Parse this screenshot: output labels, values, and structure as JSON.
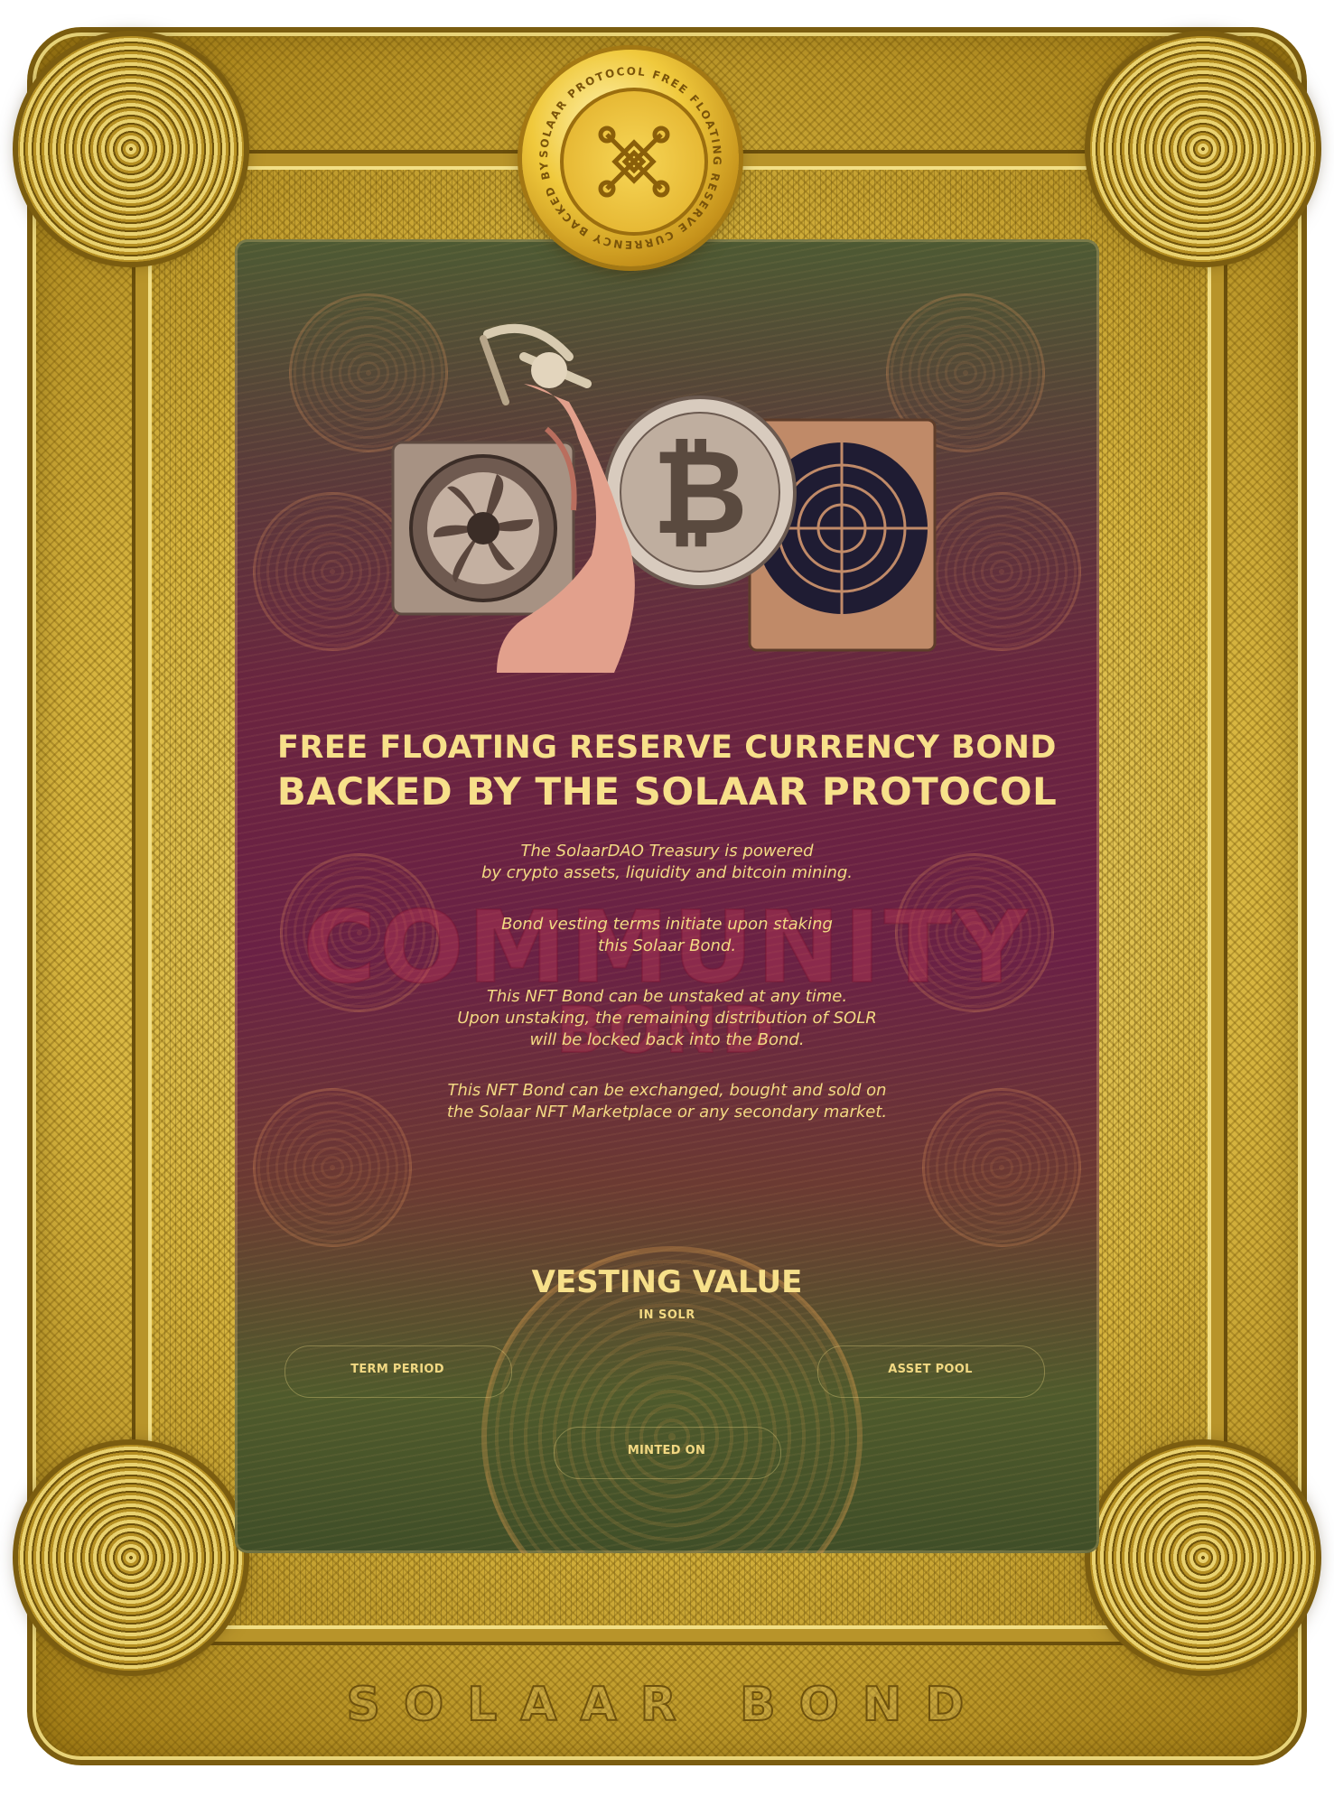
{
  "medallion": {
    "ring_text": "SOLAAR PROTOCOL FREE FLOATING RESERVE CURRENCY BACKED BY SOLAAR",
    "icon": "celtic-knot-logo"
  },
  "watermark": {
    "community": "COMMUNITY",
    "bond": "BOND"
  },
  "title": {
    "line1": "FREE FLOATING RESERVE CURRENCY BOND",
    "line2": "BACKED BY THE SOLAAR PROTOCOL"
  },
  "paragraphs": [
    {
      "line1": "The SolaarDAO Treasury is powered",
      "line2": "by crypto assets, liquidity and bitcoin mining."
    },
    {
      "line1": "Bond vesting terms initiate upon staking",
      "line2": "this Solaar Bond."
    },
    {
      "line1": "This NFT Bond can be unstaked at any time.",
      "line2": "Upon unstaking, the remaining distribution of SOLR",
      "line3": "will be locked back into the Bond."
    },
    {
      "line1": "This NFT Bond can be exchanged, bought and sold on",
      "line2": "the Solaar NFT Marketplace or any secondary market."
    }
  ],
  "vesting": {
    "title": "VESTING VALUE",
    "unit": "IN SOLR"
  },
  "fields": {
    "term_period": "TERM PERIOD",
    "asset_pool": "ASSET POOL",
    "minted_on": "MINTED ON"
  },
  "footer": {
    "brand": "SOLAAR BOND"
  },
  "colors": {
    "gold": "#d8b640",
    "text_gold": "#f7e08a",
    "panel_crimson": "#6a2145",
    "panel_olive": "#4d5a33"
  }
}
